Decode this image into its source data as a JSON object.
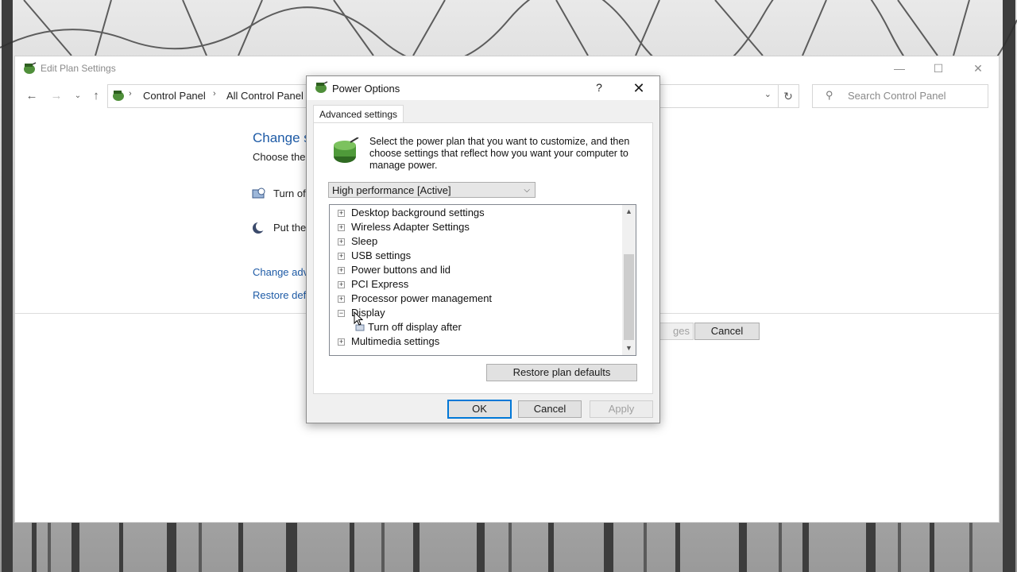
{
  "main_window": {
    "title": "Edit Plan Settings",
    "breadcrumbs": [
      "Control Panel",
      "All Control Panel"
    ],
    "search_placeholder": "Search Control Panel",
    "heading": "Change s",
    "subtext": "Choose the",
    "settings": [
      {
        "label": "Turn of",
        "icon": "display-clock-icon"
      },
      {
        "label": "Put the",
        "icon": "moon-sleep-icon"
      }
    ],
    "links": [
      "Change adv",
      "Restore defa"
    ],
    "save_button": "ges",
    "cancel_button": "Cancel"
  },
  "dialog": {
    "title": "Power Options",
    "help": "?",
    "tab": "Advanced settings",
    "description": "Select the power plan that you want to customize, and then choose settings that reflect how you want your computer to manage power.",
    "plan_selected": "High performance [Active]",
    "tree": [
      {
        "label": "Desktop background settings",
        "expanded": false
      },
      {
        "label": "Wireless Adapter Settings",
        "expanded": false
      },
      {
        "label": "Sleep",
        "expanded": false
      },
      {
        "label": "USB settings",
        "expanded": false
      },
      {
        "label": "Power buttons and lid",
        "expanded": false
      },
      {
        "label": "PCI Express",
        "expanded": false
      },
      {
        "label": "Processor power management",
        "expanded": false
      },
      {
        "label": "Display",
        "expanded": true
      },
      {
        "label": "Turn off display after",
        "child": true
      },
      {
        "label": "Multimedia settings",
        "expanded": false
      }
    ],
    "restore_button": "Restore plan defaults",
    "ok_button": "OK",
    "cancel_button": "Cancel",
    "apply_button": "Apply"
  },
  "colors": {
    "link_blue": "#1e5ba6",
    "focus_blue": "#0078d7"
  }
}
